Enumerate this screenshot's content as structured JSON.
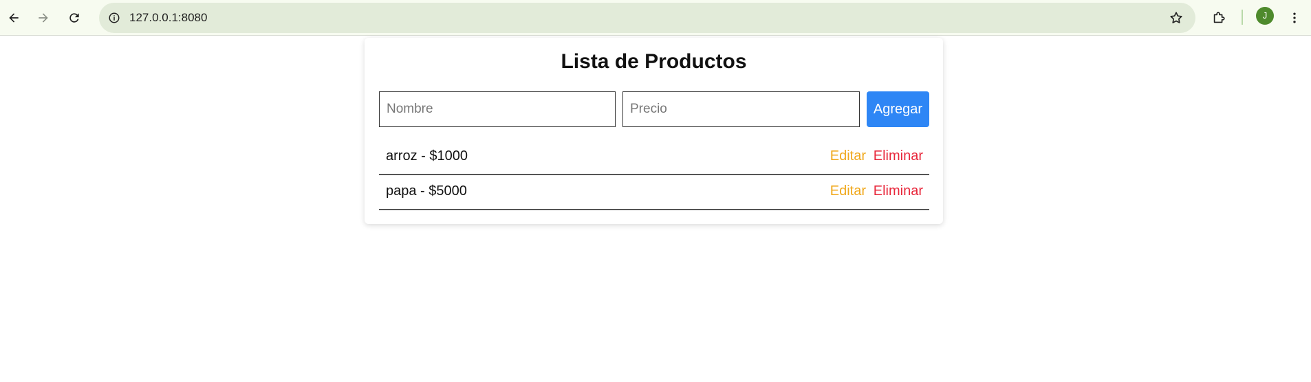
{
  "browser": {
    "url": "127.0.0.1:8080",
    "profile_initial": "J",
    "icons": {
      "back": "arrow-left-icon",
      "forward": "arrow-right-icon",
      "reload": "reload-icon",
      "site_info": "info-icon",
      "bookmark": "star-icon",
      "extensions": "puzzle-icon",
      "menu": "kebab-menu-icon"
    },
    "colors": {
      "avatar": "#4e8a2c",
      "omnibox": "#e2ebd9"
    }
  },
  "page": {
    "title": "Lista de Productos",
    "form": {
      "name_placeholder": "Nombre",
      "name_value": "",
      "price_placeholder": "Precio",
      "price_value": "",
      "add_label": "Agregar"
    },
    "products": [
      {
        "text": "arroz - $1000",
        "edit_label": "Editar",
        "delete_label": "Eliminar"
      },
      {
        "text": "papa - $5000",
        "edit_label": "Editar",
        "delete_label": "Eliminar"
      }
    ],
    "colors": {
      "add_button": "#2e86f5",
      "edit": "#f0a81c",
      "delete": "#e8283c"
    }
  }
}
